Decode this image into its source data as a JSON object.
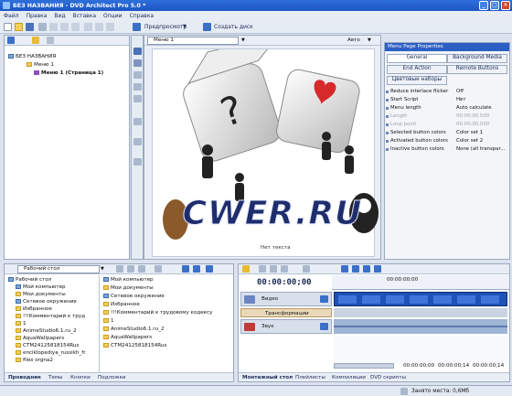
{
  "window": {
    "title": "БЕЗ НАЗВАНИЯ - DVD Architect Pro 5.0 *",
    "controls": [
      "_",
      "□",
      "✕"
    ]
  },
  "menu": [
    "Файл",
    "Правка",
    "Вид",
    "Вставка",
    "Опции",
    "Справка"
  ],
  "toolbar": {
    "preview_label": "Предпросмотр",
    "create_disc_label": "Создать диск"
  },
  "project_tree": {
    "root": "БЕЗ НАЗВАНИЯ",
    "menu": "Меню 1",
    "page": "Меню 1 (Страница 1)"
  },
  "editor": {
    "menu_select": "Меню 1",
    "zoom": "Авто",
    "no_text": "Нет текста",
    "watermark": "CWER.RU"
  },
  "props": {
    "title": "Menu Page Properties",
    "tabs": [
      "General",
      "Background Media",
      "End Action",
      "Remote Buttons",
      "Цветовые наборы"
    ],
    "rows": [
      {
        "k": "Reduce interlace flicker",
        "v": "Off",
        "dim": false
      },
      {
        "k": "Start Script",
        "v": "Нет",
        "dim": false
      },
      {
        "k": "Menu length",
        "v": "Auto calculate",
        "dim": false
      },
      {
        "k": "Length",
        "v": "00:00:00.500",
        "dim": true
      },
      {
        "k": "Loop point",
        "v": "00:00:00.000",
        "dim": true
      },
      {
        "k": "Selected button colors",
        "v": "Color set 1",
        "dim": false
      },
      {
        "k": "Activated button colors",
        "v": "Color set 2",
        "dim": false
      },
      {
        "k": "Inactive button colors",
        "v": "None (all transpar...",
        "dim": false
      }
    ]
  },
  "explorer": {
    "path": "Рабочий стол",
    "left": [
      "Рабочий стол",
      "Мой компьютер",
      "Мои документы",
      "Сетевое окружение",
      "Избранное",
      "!!!Комментарий к труд",
      "1",
      "AnimeStudio6.1.ru_2",
      "AquaWallpapers",
      "CTM24125818154Rus",
      "enciklopediya_russikh_fr",
      "files orgna2"
    ],
    "right": [
      "Мой компьютер",
      "Мои документы",
      "Сетевое окружение",
      "Избранное",
      "!!!Комментарий к трудовому кодексу",
      "1",
      "AnimeStudio6.1.ru_2",
      "AquaWallpapers",
      "CTM24125818154Rus"
    ],
    "tabs": [
      "Проводник",
      "Темы",
      "Кнопки",
      "Подложки"
    ]
  },
  "timeline": {
    "timecode": "00:00:00;00",
    "ruler": "00:00:00;00",
    "video_label": "Видео",
    "transitions_label": "Трансформации",
    "audio_label": "Звук",
    "times": [
      "00:00:00;00",
      "00:00:00;14",
      "00:00:00;14"
    ],
    "tabs": [
      "Монтажный стол",
      "Плейлисты",
      "Компиляции",
      "DVD скрипты"
    ]
  },
  "status": {
    "free_space": "Занято места: 0,6Мб"
  },
  "colors": {
    "titlebar": "#1d55c5",
    "accent": "#2f6fd9",
    "timeline_clip": "#1e52b8"
  }
}
